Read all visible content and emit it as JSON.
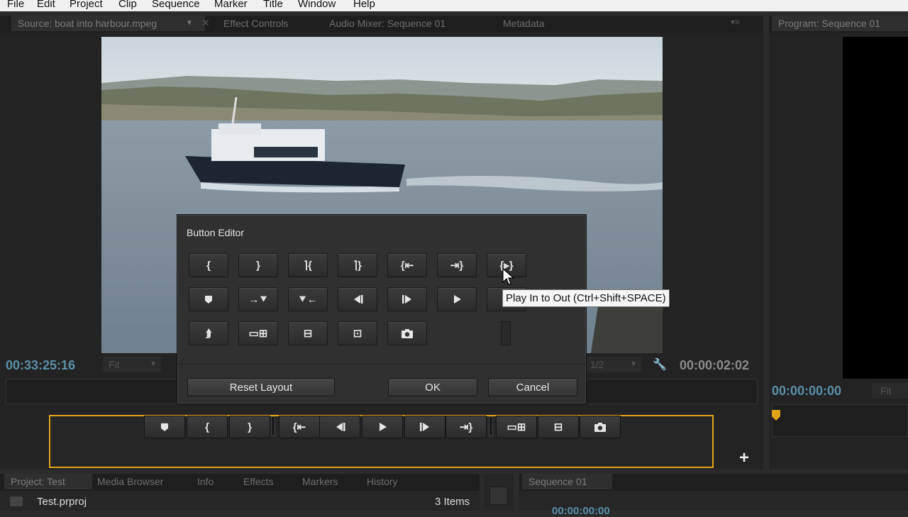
{
  "menu": [
    "File",
    "Edit",
    "Project",
    "Clip",
    "Sequence",
    "Marker",
    "Title",
    "Window",
    "Help"
  ],
  "source_panel": {
    "tabs": [
      "Source: boat into harbour.mpeg",
      "Effect Controls",
      "Audio Mixer: Sequence 01",
      "Metadata"
    ],
    "timecode_left": "00:33:25:16",
    "fit": "Fit",
    "timecode_right": "00:00:02:02",
    "resolution": "1/2"
  },
  "program_panel": {
    "tab": "Program: Sequence 01",
    "timecode": "00:00:00:00",
    "fit": "Fit"
  },
  "dialog": {
    "title": "Button Editor",
    "tooltip": "Play In to Out (Ctrl+Shift+SPACE)",
    "reset_label": "Reset Layout",
    "ok_label": "OK",
    "cancel_label": "Cancel",
    "row1": [
      "mark-in",
      "mark-out",
      "mark-clip-in",
      "mark-clip-out",
      "go-to-in",
      "go-to-out",
      "play-in-to-out"
    ],
    "row2": [
      "add-marker",
      "go-to-next-marker",
      "go-to-prev-marker",
      "step-back",
      "step-forward",
      "play",
      "loop"
    ],
    "row3": [
      "export-frame-clip",
      "insert",
      "overlay",
      "safe-margins",
      "export-frame"
    ]
  },
  "button_bar": [
    "add-marker",
    "mark-in",
    "mark-out",
    "go-to-in",
    "step-back",
    "play",
    "step-forward",
    "go-to-out",
    "insert",
    "overlay",
    "export-frame"
  ],
  "bottom_left": {
    "tabs": [
      "Project: Test",
      "Media Browser",
      "Info",
      "Effects",
      "Markers",
      "History"
    ],
    "project_name": "Test.prproj",
    "items": "3 Items"
  },
  "bottom_right": {
    "tab": "Sequence 01",
    "timecode": "00:00:00:00"
  },
  "colors": {
    "accent": "#e0a419",
    "timecode": "#5b8fa8"
  }
}
